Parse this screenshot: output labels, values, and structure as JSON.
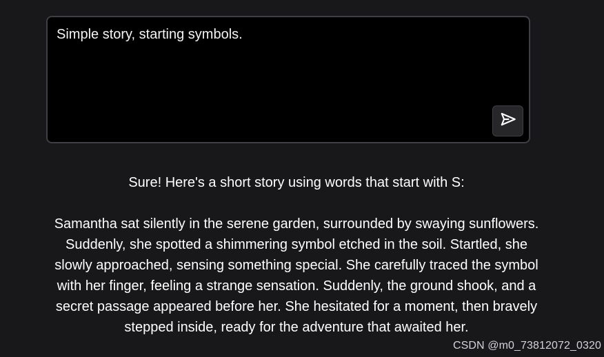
{
  "prompt": {
    "text": "Simple story, starting symbols."
  },
  "send_button": {
    "icon": "send-icon"
  },
  "response": {
    "intro": "Sure! Here's a short story using words that start with S:",
    "story": "Samantha sat silently in the serene garden, surrounded by swaying sunflowers. Suddenly, she spotted a shimmering symbol etched in the soil. Startled, she slowly approached, sensing something special. She carefully traced the symbol with her finger, feeling a strange sensation. Suddenly, the ground shook, and a secret passage appeared before her. She hesitated for a moment, then bravely stepped inside, ready for the adventure that awaited her."
  },
  "watermark": "CSDN @m0_73812072_0320",
  "colors": {
    "background": "#18181b",
    "prompt_background": "#000000",
    "border": "#3f3f46",
    "text": "#ffffff"
  }
}
